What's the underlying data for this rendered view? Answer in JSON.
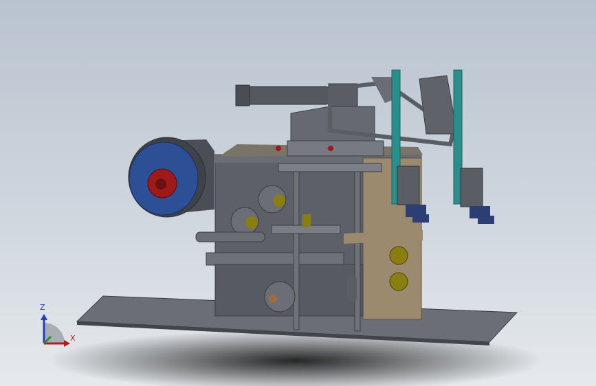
{
  "viewport": {
    "background_top": "#b9c3cf",
    "background_bottom": "#e6e9ec"
  },
  "model": {
    "parts": [
      "base-plate",
      "main-frame",
      "tape-reel",
      "pneumatic-cylinder",
      "guide-rails",
      "vertical-posts",
      "rollers",
      "carriage",
      "motors",
      "slide-table"
    ],
    "colors": {
      "frame": "#5d6068",
      "frame_dark": "#474a52",
      "base": "#6b6e76",
      "reel_blue": "#2d4f95",
      "reel_red": "#9c1a1a",
      "roller_yellow": "#8a7d12",
      "rail_teal": "#2a8f8a",
      "bronze": "#9b8a6e",
      "motor_blue": "#2c3e74"
    }
  },
  "triad": {
    "axis_z": "Z",
    "axis_x": "X",
    "color_z": "#1f3fbf",
    "color_x": "#b01c1c",
    "color_y": "#2a8c2a"
  }
}
